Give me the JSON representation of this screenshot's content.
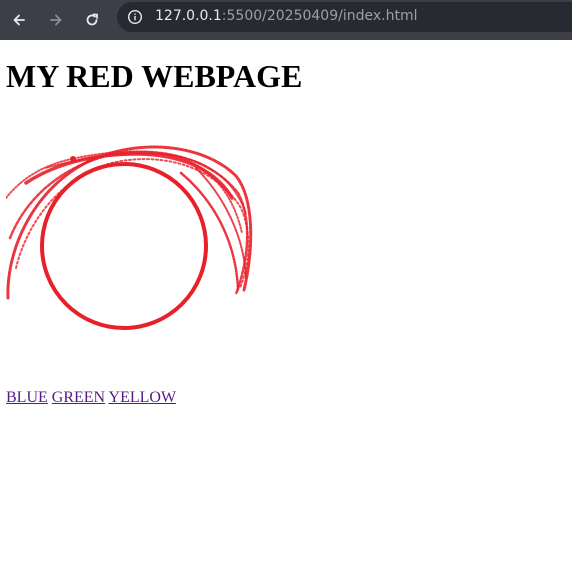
{
  "browser": {
    "url_host": "127.0.0.1",
    "url_path": ":5500/20250409/index.html",
    "icons": [
      "back-arrow-icon",
      "forward-arrow-icon",
      "reload-icon",
      "info-icon"
    ]
  },
  "page": {
    "heading": "MY RED WEBPAGE",
    "links": [
      {
        "label": "BLUE"
      },
      {
        "label": "GREEN"
      },
      {
        "label": "YELLOW"
      }
    ],
    "drawing": {
      "color": "#e8202a",
      "description_icon": "red-circle-scribble-drawing"
    },
    "link_color": "#551a8b"
  }
}
